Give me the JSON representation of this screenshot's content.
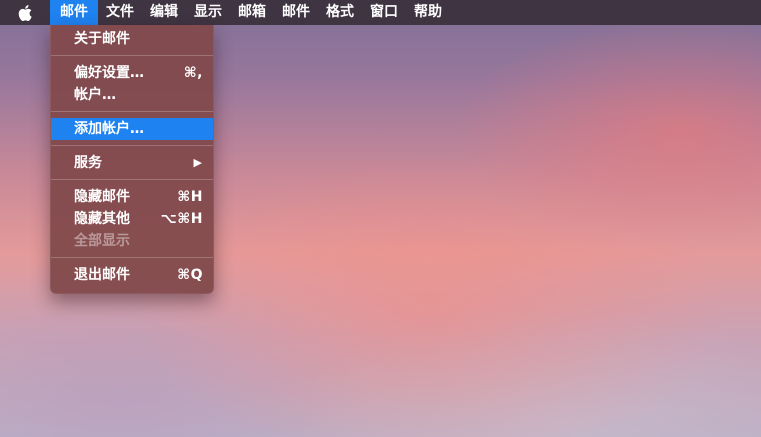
{
  "menubar": {
    "apple_icon": "apple-icon",
    "items": [
      {
        "label": "邮件"
      },
      {
        "label": "文件"
      },
      {
        "label": "编辑"
      },
      {
        "label": "显示"
      },
      {
        "label": "邮箱"
      },
      {
        "label": "邮件"
      },
      {
        "label": "格式"
      },
      {
        "label": "窗口"
      },
      {
        "label": "帮助"
      }
    ],
    "active_index": 0,
    "highlight_color": "#1e82f0",
    "bar_color": "#3f3442"
  },
  "dropdown": {
    "about": {
      "label": "关于邮件"
    },
    "preferences": {
      "label": "偏好设置…",
      "shortcut": "⌘,"
    },
    "accounts": {
      "label": "帐户…"
    },
    "add_account": {
      "label": "添加帐户…"
    },
    "services": {
      "label": "服务",
      "submenu_icon": "triangle-right-icon",
      "arrow": "▶"
    },
    "hide_mail": {
      "label": "隐藏邮件",
      "shortcut": "⌘H"
    },
    "hide_others": {
      "label": "隐藏其他",
      "shortcut": "⌥⌘H"
    },
    "show_all": {
      "label": "全部显示"
    },
    "quit": {
      "label": "退出邮件",
      "shortcut": "⌘Q"
    }
  }
}
